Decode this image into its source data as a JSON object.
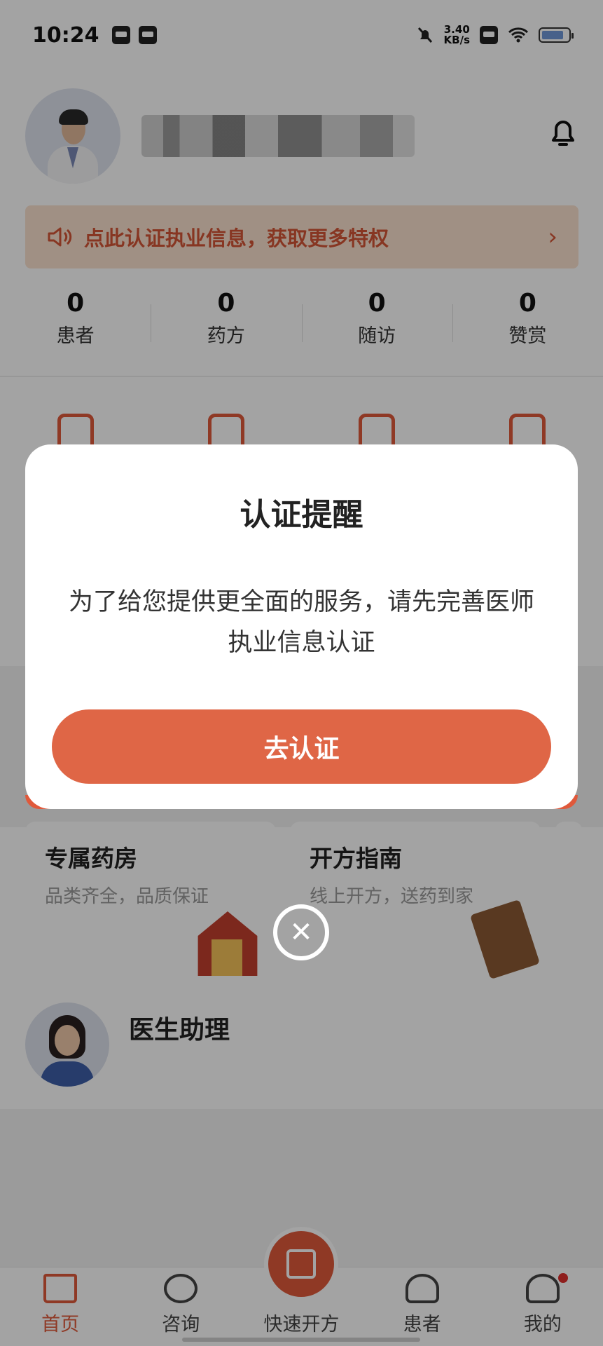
{
  "status_bar": {
    "time": "10:24",
    "net_speed": "3.40",
    "net_unit": "KB/s"
  },
  "banner": {
    "text": "点此认证执业信息，获取更多特权"
  },
  "stats": [
    {
      "value": "0",
      "label": "患者"
    },
    {
      "value": "0",
      "label": "药方"
    },
    {
      "value": "0",
      "label": "随访"
    },
    {
      "value": "0",
      "label": "赞赏"
    }
  ],
  "cards": [
    {
      "title": "专属药房",
      "subtitle": "品类齐全，品质保证"
    },
    {
      "title": "开方指南",
      "subtitle": "线上开方，送药到家"
    }
  ],
  "assistant": {
    "title": "医生助理"
  },
  "modal": {
    "title": "认证提醒",
    "body": "为了给您提供更全面的服务，请先完善医师执业信息认证",
    "button": "去认证"
  },
  "tabs": [
    {
      "label": "首页",
      "icon": "home-icon",
      "active": true
    },
    {
      "label": "咨询",
      "icon": "chat-icon"
    },
    {
      "label": "快速开方",
      "icon": "prescribe-icon"
    },
    {
      "label": "患者",
      "icon": "patients-icon"
    },
    {
      "label": "我的",
      "icon": "profile-icon"
    }
  ],
  "colors": {
    "accent": "#e0593b",
    "banner_bg": "#fbe2cf",
    "button": "#df6646"
  }
}
